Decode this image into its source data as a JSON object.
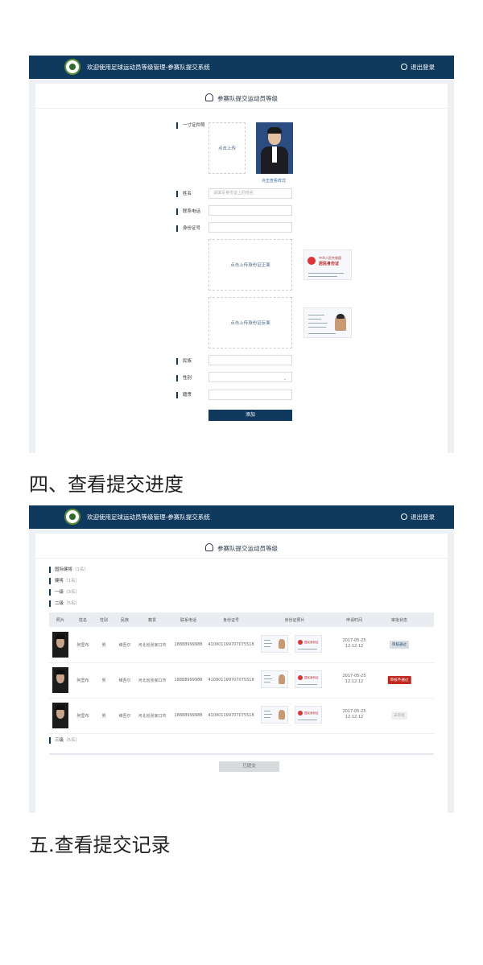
{
  "app": {
    "title": "欢迎使用足球运动员等级管理-参赛队提交系统",
    "logout_label": "退出登录",
    "card_title": "参赛队提交运动员等级"
  },
  "form": {
    "photo_label": "一寸证件照",
    "upload_click": "点击上传",
    "view_sample": "点击查看样式",
    "name_label": "姓名",
    "name_placeholder": "请填写身份证上的姓名",
    "phone_label": "联系电话",
    "id_label": "身份证号",
    "id_front_upload": "点击上传身份证正面",
    "id_back_upload": "点击上传身份证反面",
    "ethnicity_label": "民族",
    "gender_label": "性别",
    "origin_label": "籍贯",
    "add_button": "添加",
    "idcard_sample": {
      "country": "中华人民共和国",
      "title": "居民身份证"
    }
  },
  "headings": {
    "section4": "四、查看提交进度",
    "section5": "五.查看提交记录"
  },
  "progress": {
    "levels": [
      {
        "name": "国际健将",
        "count": "（1名）"
      },
      {
        "name": "健将",
        "count": "（1名）"
      },
      {
        "name": "一级",
        "count": "（3名）"
      },
      {
        "name": "二级",
        "count": "（5名）"
      }
    ],
    "level3": {
      "name": "三级",
      "count": "（5名）"
    },
    "columns": [
      "照片",
      "姓名",
      "性别",
      "民族",
      "籍贯",
      "联系电话",
      "身份证号",
      "身份证照片",
      "申请时间",
      "审批状态"
    ],
    "rows": [
      {
        "name": "阿里布",
        "gender": "男",
        "ethnicity": "维吾尔",
        "origin": "河北省张家口市",
        "phone": "18888999988",
        "id_number": "410901199707075518",
        "date": "2017-05-25",
        "time": "12:12:12",
        "status": "审核通过",
        "status_type": "ok"
      },
      {
        "name": "阿里布",
        "gender": "男",
        "ethnicity": "维吾尔",
        "origin": "河北省张家口市",
        "phone": "18888999988",
        "id_number": "410901199707075518",
        "date": "2017-05-25",
        "time": "12:12:12",
        "status": "审核不通过",
        "status_type": "fail"
      },
      {
        "name": "阿里布",
        "gender": "男",
        "ethnicity": "维吾尔",
        "origin": "河北省张家口市",
        "phone": "18888999988",
        "id_number": "410901199707075518",
        "date": "2017-05-25",
        "time": "12:12:12",
        "status": "未审批",
        "status_type": "wait"
      }
    ],
    "submitted_button": "已提交"
  },
  "colors": {
    "navy": "#0f3a5e",
    "fail_red": "#c0291f"
  }
}
